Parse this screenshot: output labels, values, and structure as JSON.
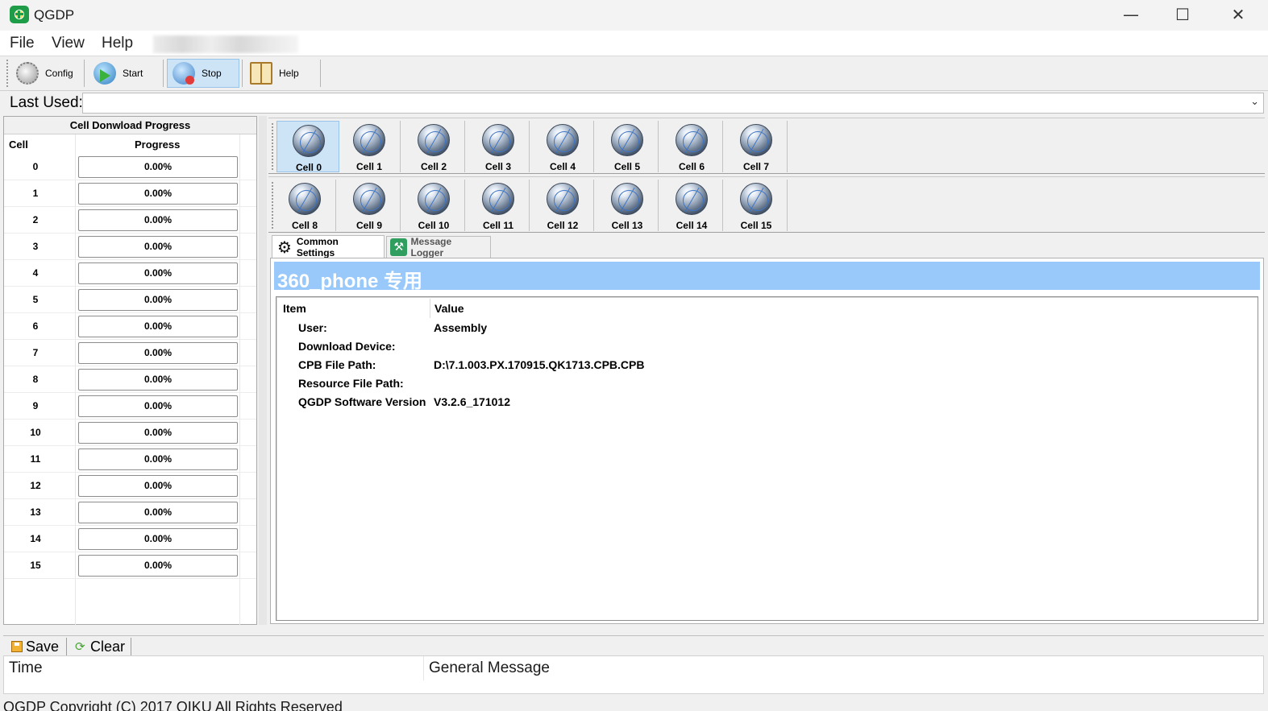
{
  "window": {
    "title": "QGDP"
  },
  "menu": {
    "items": [
      "File",
      "View",
      "Help"
    ]
  },
  "toolbar": {
    "config_label": "Config",
    "start_label": "Start",
    "stop_label": "Stop",
    "help_label": "Help",
    "active": "Stop"
  },
  "last_used": {
    "label": "Last Used:",
    "value": ""
  },
  "progress_panel": {
    "title": "Cell Donwload Progress",
    "col_cell": "Cell",
    "col_progress": "Progress",
    "rows": [
      {
        "cell": "0",
        "progress": "0.00%"
      },
      {
        "cell": "1",
        "progress": "0.00%"
      },
      {
        "cell": "2",
        "progress": "0.00%"
      },
      {
        "cell": "3",
        "progress": "0.00%"
      },
      {
        "cell": "4",
        "progress": "0.00%"
      },
      {
        "cell": "5",
        "progress": "0.00%"
      },
      {
        "cell": "6",
        "progress": "0.00%"
      },
      {
        "cell": "7",
        "progress": "0.00%"
      },
      {
        "cell": "8",
        "progress": "0.00%"
      },
      {
        "cell": "9",
        "progress": "0.00%"
      },
      {
        "cell": "10",
        "progress": "0.00%"
      },
      {
        "cell": "11",
        "progress": "0.00%"
      },
      {
        "cell": "12",
        "progress": "0.00%"
      },
      {
        "cell": "13",
        "progress": "0.00%"
      },
      {
        "cell": "14",
        "progress": "0.00%"
      },
      {
        "cell": "15",
        "progress": "0.00%"
      }
    ]
  },
  "cells": {
    "selected": "Cell 0",
    "labels": [
      "Cell 0",
      "Cell 1",
      "Cell 2",
      "Cell 3",
      "Cell 4",
      "Cell 5",
      "Cell 6",
      "Cell 7",
      "Cell 8",
      "Cell 9",
      "Cell 10",
      "Cell 11",
      "Cell 12",
      "Cell 13",
      "Cell 14",
      "Cell 15"
    ]
  },
  "tabs": {
    "common_settings": "Common Settings",
    "message_logger": "Message Logger",
    "active": "Common Settings"
  },
  "main": {
    "banner": "360_phone 专用",
    "col_item": "Item",
    "col_value": "Value",
    "rows": [
      {
        "label": "User:",
        "value": "Assembly"
      },
      {
        "label": "Download Device:",
        "value": ""
      },
      {
        "label": "CPB File Path:",
        "value": "D:\\7.1.003.PX.170915.QK1713.CPB.CPB"
      },
      {
        "label": "Resource File Path:",
        "value": ""
      },
      {
        "label": "QGDP Software Version",
        "value": "V3.2.6_171012"
      }
    ]
  },
  "log": {
    "save_label": "Save",
    "clear_label": "Clear",
    "col_time": "Time",
    "col_message": "General Message"
  },
  "status": {
    "text": "QGDP Copyright (C) 2017 QIKU All Rights Reserved"
  },
  "colors": {
    "banner": "#99c9fb",
    "active_button": "#cde4f7",
    "app_icon": "#1e9c47"
  }
}
